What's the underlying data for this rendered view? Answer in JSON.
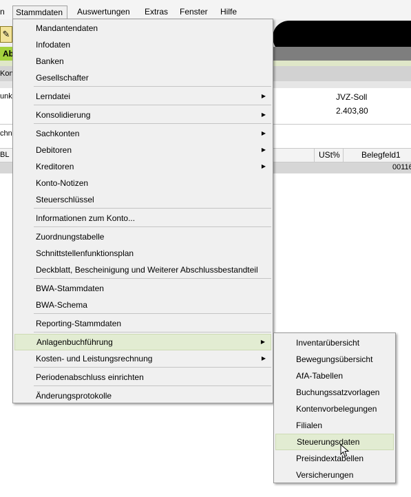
{
  "menubar": {
    "items": [
      "n",
      "Stammdaten",
      "Auswertungen",
      "Extras",
      "Fenster",
      "Hilfe"
    ]
  },
  "background": {
    "tab_fragment": "Ab",
    "konto_fragment": "Konto",
    "funkt_fragment": "unkt",
    "zeichn_fragment": "chne",
    "bl_fragment": "BL",
    "soll_label": "JVZ-Soll",
    "soll_value": "2.403,80",
    "columns": [
      "USt%",
      "Belegfeld1"
    ],
    "row_value_fragment": "00116"
  },
  "main_menu": {
    "items": [
      "Mandantendaten",
      "Infodaten",
      "Banken",
      "Gesellschafter",
      "Lerndatei",
      "Konsolidierung",
      "Sachkonten",
      "Debitoren",
      "Kreditoren",
      "Konto-Notizen",
      "Steuerschlüssel",
      "Informationen zum Konto...",
      "Zuordnungstabelle",
      "Schnittstellenfunktionsplan",
      "Deckblatt, Bescheinigung und Weiterer Abschlussbestandteil",
      "BWA-Stammdaten",
      "BWA-Schema",
      "Reporting-Stammdaten",
      "Anlagenbuchführung",
      "Kosten- und Leistungsrechnung",
      "Periodenabschluss einrichten",
      "Änderungsprotokolle"
    ],
    "highlighted": "Anlagenbuchführung"
  },
  "sub_menu": {
    "items": [
      "Inventarübersicht",
      "Bewegungsübersicht",
      "AfA-Tabellen",
      "Buchungssatzvorlagen",
      "Kontenvorbelegungen",
      "Filialen",
      "Steuerungsdaten",
      "Preisindextabellen",
      "Versicherungen"
    ],
    "highlighted": "Steuerungsdaten"
  },
  "icons": {
    "submenu_arrow": "triangle-right-icon",
    "cursor": "mouse-pointer-icon",
    "tool": "tool-icon"
  },
  "colors": {
    "menu_bg": "#f0f0f0",
    "highlight": "#e2ecd2",
    "tab_active": "#a4d23e"
  }
}
